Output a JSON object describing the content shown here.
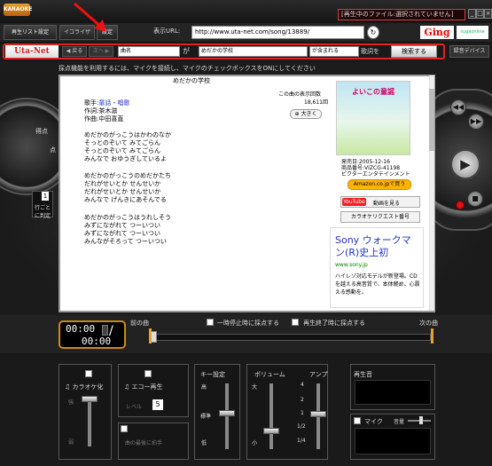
{
  "titlebar": {
    "app_logo": "KARAOKE",
    "status": "[再生中のファイル:選択されていません]",
    "buttons": [
      "_",
      "□",
      "×"
    ]
  },
  "toolbar": {
    "playlist_btn": "再生リスト設定",
    "equalizer_btn": "イコライザ",
    "settings_btn": "設定",
    "url_label": "表示URL:",
    "url_value": "http://www.uta-net.com/song/13889/",
    "go_icon": "↻",
    "ging_logo": "Ging",
    "partner_logo": "sugaonline"
  },
  "search": {
    "logo": "Uta-Net",
    "back_label": "◀ 戻る",
    "forward_label": "次へ ▶",
    "field_select": "曲名",
    "wa_label": "が",
    "query": "めだかの学校",
    "match_select": "が含まれる",
    "kashi_label": "歌詞を",
    "search_btn": "検索する",
    "device_btn": "録音デバイス"
  },
  "notice": "採点機能を利用するには、マイクを接続し、マイクのチェックボックスをONにしてください",
  "stage": {
    "score_label": "得点",
    "point_label": "点",
    "perline_top": "1行",
    "perline_bottom": "行ごとに判定",
    "perline_value": "1"
  },
  "browser": {
    "song_title": "めだかの学校",
    "viewcount_label": "この曲の表示回数",
    "viewcount_value": "18,611回",
    "zoom_btn": "大きく",
    "meta_singer_label": "歌手:",
    "meta_singer_value": "童話・唱歌",
    "meta_lyricist": "作詞:茶木滋",
    "meta_composer": "作曲:中田喜直",
    "lyrics": [
      "めだかのがっこうはかわのなか",
      "そっとのぞいて みてごらん",
      "そっとのぞいて みてごらん",
      "みんなで おゆうぎしているよ",
      "",
      "めだかのがっこうのめだかたち",
      "だれがせいとか せんせいか",
      "だれがせいとか せんせいか",
      "みんなで げんきにあそんでる",
      "",
      "めだかのがっこうはうれしそう",
      "みずにながれて つーいつい",
      "みずにながれて つーいつい",
      "みんながそろって つーいつい"
    ],
    "album_title": "よいこの童謡",
    "release_date": "発売日:2005-12-16",
    "product_no": "商品番号:VIZCG-41198",
    "label": "ビクターエンタテインメント",
    "amazon_btn": "Amazon.co.jpで買う",
    "youtube_badge": "YouTube",
    "video_btn": "動画を見る",
    "request_btn": "カラオケリクエスト番号",
    "ad_title": "Sony ウォークマン(R)史上初",
    "ad_url": "www.sony.jp",
    "ad_body": "ハイレゾ対応モデルが新登場。CDを越える高音質で、本体軽め、心震える感動を。"
  },
  "progress": {
    "prev_label": "前の曲",
    "next_label": "次の曲",
    "pause_score_label": "一時停止時に採点する",
    "end_score_label": "再生終了時に採点する",
    "elapsed": "00:00",
    "total": "00:00",
    "position": 0
  },
  "bottom": {
    "karaoke_label": "カラオケ化",
    "karaoke_top": "強",
    "karaoke_bottom": "弱",
    "echo_label": "エコー再生",
    "level_label": "レベル",
    "level_value": "5",
    "last_btn": "曲の最後に拍手",
    "key_label": "キー設定",
    "key_high": "高",
    "key_std": "標準",
    "key_low": "低",
    "volume_label": "ボリューム",
    "vol_high": "大",
    "vol_low": "小",
    "amp_label": "アンプ",
    "amp_ticks": [
      "4",
      "2",
      "1",
      "1/2",
      "1/4"
    ],
    "playback_label": "再生音",
    "mic_label": "マイク",
    "mic_vol_label": "音量"
  }
}
